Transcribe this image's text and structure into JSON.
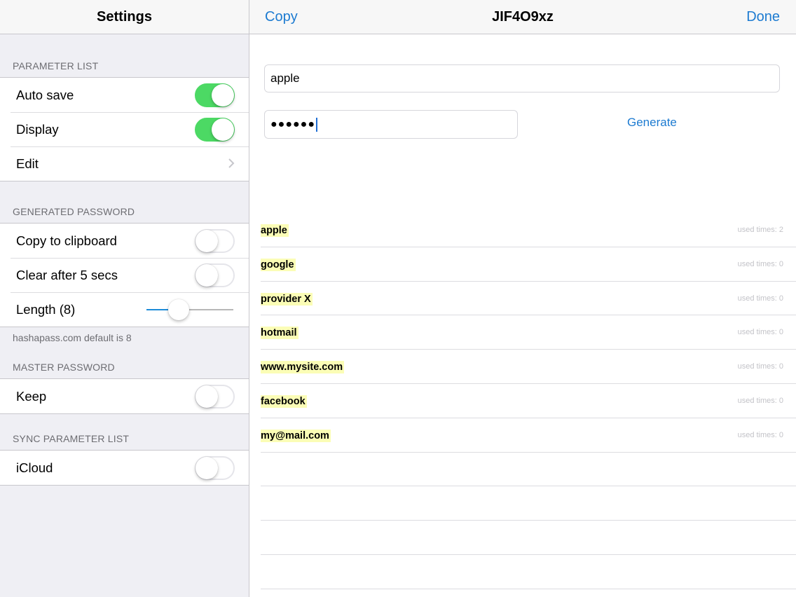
{
  "left": {
    "title": "Settings",
    "sections": [
      {
        "header": "PARAMETER LIST",
        "rows": [
          {
            "label": "Auto save",
            "control": "toggle",
            "on": true
          },
          {
            "label": "Display",
            "control": "toggle",
            "on": true
          },
          {
            "label": "Edit",
            "control": "chevron"
          }
        ]
      },
      {
        "header": "GENERATED PASSWORD",
        "rows": [
          {
            "label": "Copy to clipboard",
            "control": "toggle",
            "on": false
          },
          {
            "label": "Clear after 5 secs",
            "control": "toggle",
            "on": false
          },
          {
            "label": "Length (8)",
            "control": "slider",
            "value_fraction": 0.37
          }
        ],
        "footer": "hashapass.com default is 8"
      },
      {
        "header": "MASTER PASSWORD",
        "rows": [
          {
            "label": "Keep",
            "control": "toggle",
            "on": false
          }
        ]
      },
      {
        "header": "SYNC PARAMETER LIST",
        "rows": [
          {
            "label": "iCloud",
            "control": "toggle",
            "on": false
          }
        ]
      }
    ]
  },
  "right": {
    "copy_label": "Copy",
    "title": "JIF4O9xz",
    "done_label": "Done",
    "parameter_value": "apple",
    "password_masked": "●●●●●●",
    "generate_label": "Generate",
    "entries": [
      {
        "name": "apple",
        "count": "used times: 2"
      },
      {
        "name": "google",
        "count": "used times: 0"
      },
      {
        "name": "provider X",
        "count": "used times: 0"
      },
      {
        "name": "hotmail",
        "count": "used times: 0"
      },
      {
        "name": "www.mysite.com",
        "count": "used times: 0"
      },
      {
        "name": "facebook",
        "count": "used times: 0"
      },
      {
        "name": "my@mail.com",
        "count": "used times: 0"
      }
    ],
    "empty_rows": 4
  },
  "colors": {
    "accent": "#1d7bd1",
    "toggle_on": "#4cd964",
    "highlight": "#fbfdb6",
    "grouped_background": "#efeff4"
  }
}
